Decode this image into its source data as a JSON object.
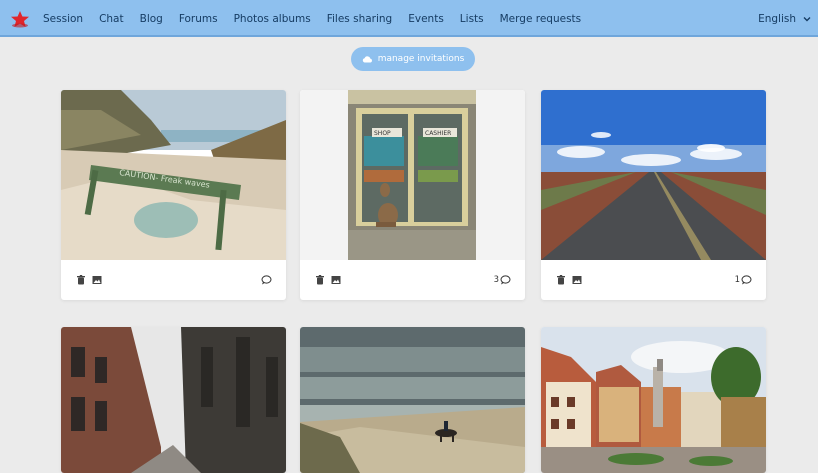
{
  "nav": {
    "logo_icon": "red-star-logo",
    "items": [
      "Session",
      "Chat",
      "Blog",
      "Forums",
      "Photos albums",
      "Files sharing",
      "Events",
      "Lists",
      "Merge requests"
    ],
    "language": "English"
  },
  "manage": {
    "label": "manage invitations",
    "icon": "cloud-icon"
  },
  "cards": [
    {
      "image": "beach dunes with caution sign",
      "sign_text": "CAUTION- Freak waves",
      "comments": ""
    },
    {
      "image": "kangaroo in front of shop",
      "shop_text": "SHOP",
      "cashier_text": "CASHIER",
      "comments": "3"
    },
    {
      "image": "outback road under blue sky",
      "comments": "1"
    },
    {
      "image": "cathedral street"
    },
    {
      "image": "rider on horse at beach"
    },
    {
      "image": "town square with statue"
    }
  ],
  "colors": {
    "topbar": "#8ec0ee",
    "background": "#ebebeb",
    "text": "#163c63"
  }
}
